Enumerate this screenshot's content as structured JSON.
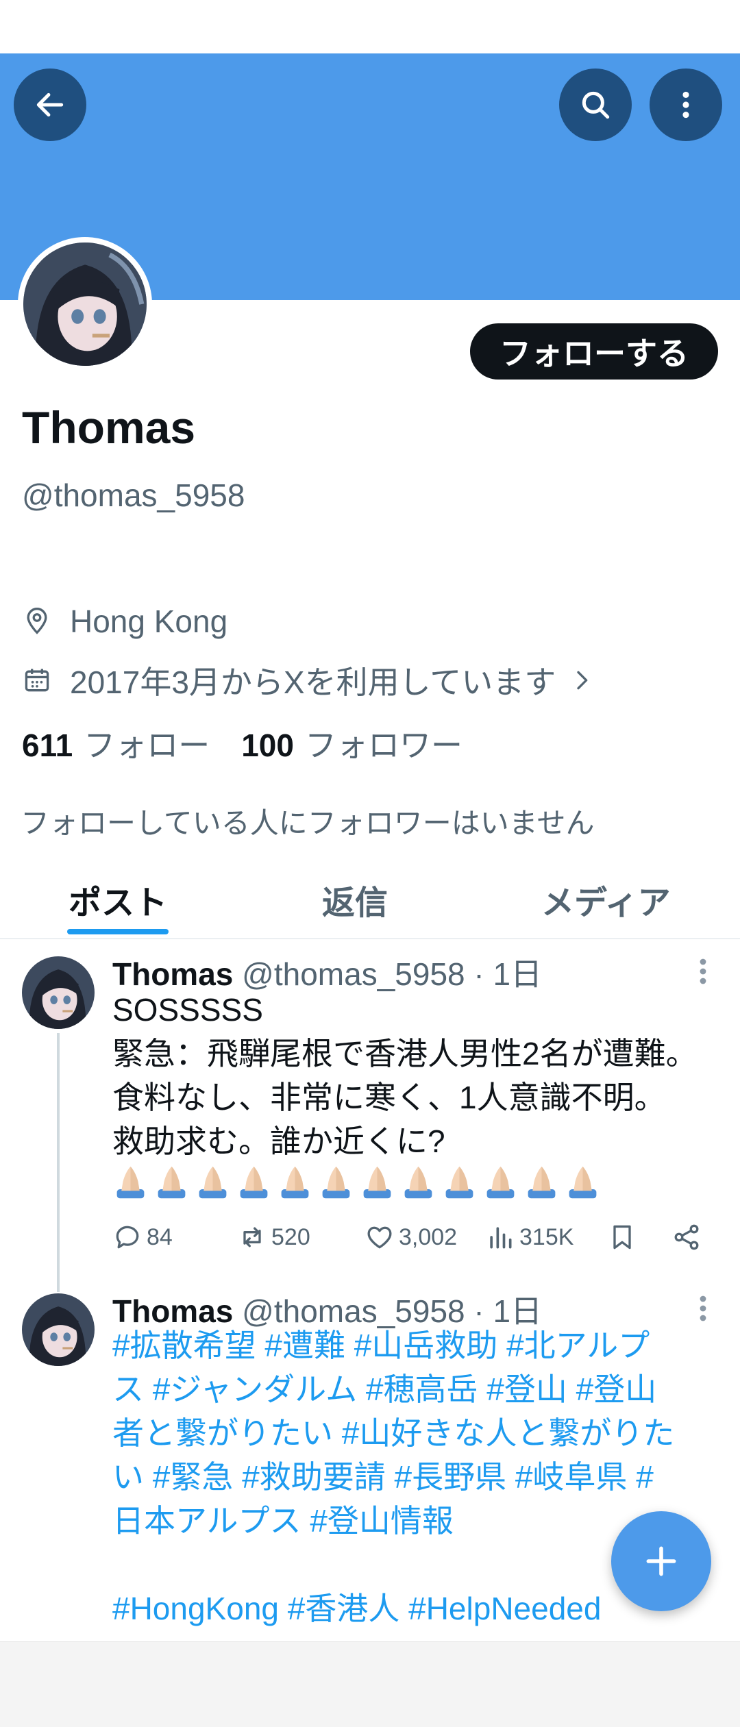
{
  "profile": {
    "follow_label": "フォローする",
    "name": "Thomas",
    "handle": "@thomas_5958",
    "location": "Hong Kong",
    "joined": "2017年3月からXを利用しています",
    "following_count": "611",
    "following_label": "フォロー",
    "followers_count": "100",
    "followers_label": "フォロワー",
    "mutual_note": "フォローしている人にフォロワーはいません"
  },
  "tabs": [
    {
      "label": "ポスト",
      "active": true
    },
    {
      "label": "返信",
      "active": false
    },
    {
      "label": "メディア",
      "active": false
    }
  ],
  "posts": [
    {
      "author": "Thomas",
      "handle": "@thomas_5958",
      "time": "· 1日",
      "text": "SOSSSSS\n緊急：飛騨尾根で香港人男性2名が遭難。\n食料なし、非常に寒く、1人意識不明。\n救助求む。誰か近くに?",
      "emoji_count": 12,
      "replies": "84",
      "reposts": "520",
      "likes": "3,002",
      "views": "315K"
    },
    {
      "author": "Thomas",
      "handle": "@thomas_5958",
      "time": "· 1日",
      "tags_line1": "#拡散希望 #遭難 #山岳救助 #北アルプ\nス #ジャンダルム #穂高岳 #登山 #登山\n者と繋がりたい #山好きな人と繋がりた\nい #緊急 #救助要請 #長野県 #岐阜県 #\n日本アルプス #登山情報",
      "tags_line2": "#HongKong #香港人 #HelpNeeded"
    }
  ],
  "colors": {
    "banner": "#4d9aea",
    "accent": "#1d9bf0",
    "follow_button": "#0f1419"
  },
  "icons": [
    "back-arrow-icon",
    "search-icon",
    "more-vertical-icon",
    "location-pin-icon",
    "calendar-icon",
    "chevron-right-icon",
    "reply-icon",
    "repost-icon",
    "like-icon",
    "views-icon",
    "bookmark-icon",
    "share-icon",
    "plus-icon"
  ]
}
